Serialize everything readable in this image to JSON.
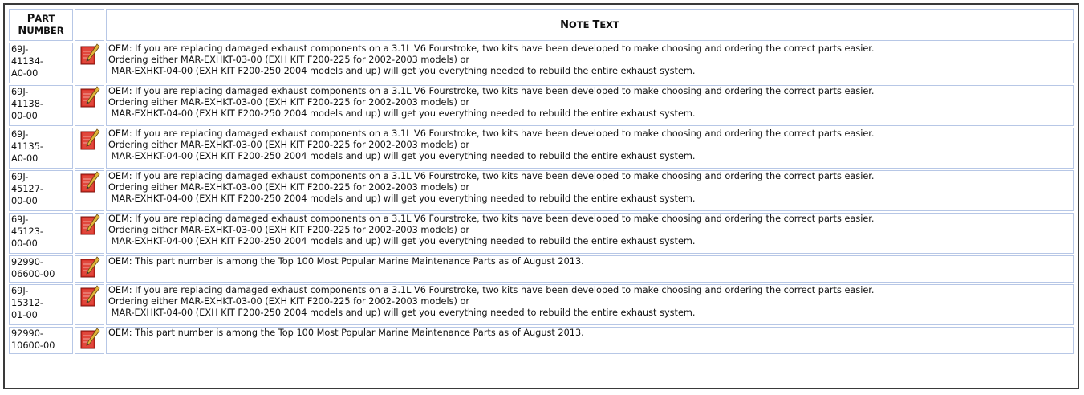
{
  "table": {
    "headers": {
      "part_number": "PART NUMBER",
      "part_number_line1_first": "P",
      "part_number_line1_rest": "ART",
      "part_number_line2_first": "N",
      "part_number_line2_rest": "UMBER",
      "note_text_first1": "N",
      "note_text_rest1": "OTE ",
      "note_text_first2": "T",
      "note_text_rest2": "EXT"
    },
    "rows": [
      {
        "part_number": "69J-\n41134-\nA0-00",
        "icon": "note-pencil-icon",
        "note_line1": "OEM: If you are replacing damaged exhaust components on a 3.1L V6 Fourstroke, two kits have been developed to make choosing and ordering the correct parts easier.",
        "note_line2": "Ordering either MAR-EXHKT-03-00 (EXH KIT F200-225 for 2002-2003 models) or",
        "note_line3": " MAR-EXHKT-04-00 (EXH KIT F200-250 2004 models and up) will get you everything needed to rebuild the entire exhaust system."
      },
      {
        "part_number": "69J-\n41138-\n00-00",
        "icon": "note-pencil-icon",
        "note_line1": "OEM: If you are replacing damaged exhaust components on a 3.1L V6 Fourstroke, two kits have been developed to make choosing and ordering the correct parts easier.",
        "note_line2": "Ordering either MAR-EXHKT-03-00 (EXH KIT F200-225 for 2002-2003 models) or",
        "note_line3": " MAR-EXHKT-04-00 (EXH KIT F200-250 2004 models and up) will get you everything needed to rebuild the entire exhaust system."
      },
      {
        "part_number": "69J-\n41135-\nA0-00",
        "icon": "note-pencil-icon",
        "note_line1": "OEM: If you are replacing damaged exhaust components on a 3.1L V6 Fourstroke, two kits have been developed to make choosing and ordering the correct parts easier.",
        "note_line2": "Ordering either MAR-EXHKT-03-00 (EXH KIT F200-225 for 2002-2003 models) or",
        "note_line3": " MAR-EXHKT-04-00 (EXH KIT F200-250 2004 models and up) will get you everything needed to rebuild the entire exhaust system."
      },
      {
        "part_number": "69J-\n45127-\n00-00",
        "icon": "note-pencil-icon",
        "note_line1": "OEM: If you are replacing damaged exhaust components on a 3.1L V6 Fourstroke, two kits have been developed to make choosing and ordering the correct parts easier.",
        "note_line2": "Ordering either MAR-EXHKT-03-00 (EXH KIT F200-225 for 2002-2003 models) or",
        "note_line3": " MAR-EXHKT-04-00 (EXH KIT F200-250 2004 models and up) will get you everything needed to rebuild the entire exhaust system."
      },
      {
        "part_number": "69J-\n45123-\n00-00",
        "icon": "note-pencil-icon",
        "note_line1": "OEM: If you are replacing damaged exhaust components on a 3.1L V6 Fourstroke, two kits have been developed to make choosing and ordering the correct parts easier.",
        "note_line2": "Ordering either MAR-EXHKT-03-00 (EXH KIT F200-225 for 2002-2003 models) or",
        "note_line3": " MAR-EXHKT-04-00 (EXH KIT F200-250 2004 models and up) will get you everything needed to rebuild the entire exhaust system."
      },
      {
        "part_number": "92990-\n06600-00",
        "icon": "note-pencil-icon",
        "note_line1": "OEM: This part number is among the Top 100 Most Popular Marine Maintenance Parts as of August 2013.",
        "note_line2": "",
        "note_line3": ""
      },
      {
        "part_number": "69J-\n15312-\n01-00",
        "icon": "note-pencil-icon",
        "note_line1": "OEM: If you are replacing damaged exhaust components on a 3.1L V6 Fourstroke, two kits have been developed to make choosing and ordering the correct parts easier.",
        "note_line2": "Ordering either MAR-EXHKT-03-00 (EXH KIT F200-225 for 2002-2003 models) or",
        "note_line3": " MAR-EXHKT-04-00 (EXH KIT F200-250 2004 models and up) will get you everything needed to rebuild the entire exhaust system."
      },
      {
        "part_number": "92990-\n10600-00",
        "icon": "note-pencil-icon",
        "note_line1": "OEM: This part number is among the Top 100 Most Popular Marine Maintenance Parts as of August 2013.",
        "note_line2": "",
        "note_line3": ""
      }
    ]
  },
  "colors": {
    "cell_border": "#b7c7e6",
    "frame_border": "#3a3a3a",
    "icon_red": "#d82a1f",
    "icon_pencil": "#e0b43a"
  }
}
